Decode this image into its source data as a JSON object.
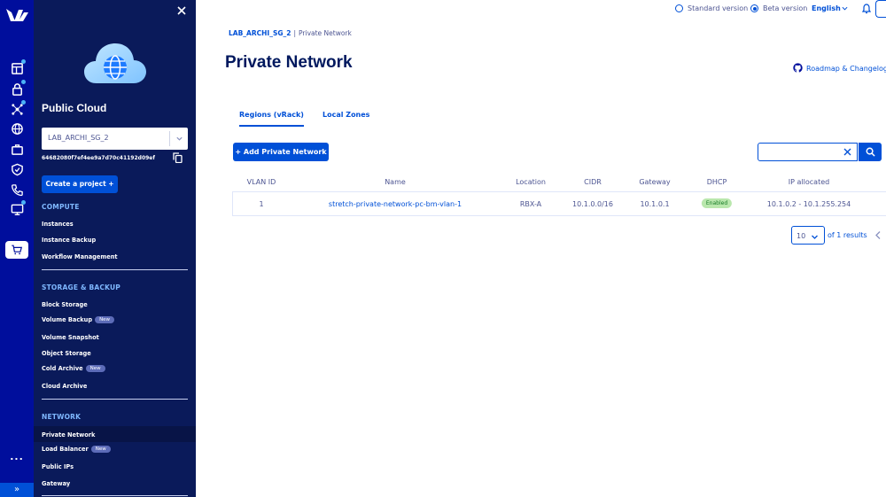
{
  "sidebar": {
    "title": "Public Cloud",
    "project_name": "LAB_ARCHI_SG_2",
    "project_id": "64682080f7ef4ee9a7d70c41192d09ef",
    "create_project_label": "Create a project +",
    "sections": {
      "compute": {
        "title": "COMPUTE",
        "items": [
          "Instances",
          "Instance Backup",
          "Workflow Management"
        ]
      },
      "storage": {
        "title": "STORAGE & BACKUP",
        "items": [
          "Block Storage",
          "Volume Backup",
          "Volume Snapshot",
          "Object Storage",
          "Cold Archive",
          "Cloud Archive"
        ]
      },
      "network": {
        "title": "NETWORK",
        "items": [
          "Private Network",
          "Load Balancer",
          "Public IPs",
          "Gateway"
        ]
      }
    },
    "new_badge": "New",
    "active_item": "Private Network"
  },
  "rail": {
    "more_label": "...",
    "expand_label": "»"
  },
  "topbar": {
    "standard_version": "Standard version",
    "beta_version": "Beta version",
    "selected_version": "Beta version",
    "language": "English"
  },
  "breadcrumb": {
    "project": "LAB_ARCHI_SG_2",
    "separator": "|",
    "current": "Private Network"
  },
  "page": {
    "title": "Private Network",
    "roadmap_label": "Roadmap & Changelog",
    "tabs": [
      "Regions (vRack)",
      "Local Zones"
    ],
    "active_tab": "Regions (vRack)",
    "add_button": "+ Add Private Network",
    "search_value": ""
  },
  "table": {
    "columns": [
      "VLAN ID",
      "Name",
      "Location",
      "CIDR",
      "Gateway",
      "DHCP",
      "IP allocated"
    ],
    "rows": [
      {
        "vlan_id": "1",
        "name": "stretch-private-network-pc-bm-vlan-1",
        "location": "RBX-A",
        "cidr": "10.1.0.0/16",
        "gateway": "10.1.0.1",
        "dhcp": "Enabled",
        "ip_allocated": "10.1.0.2 - 10.1.255.254"
      }
    ]
  },
  "pagination": {
    "per_page": "10",
    "results": "of 1 results"
  },
  "colors": {
    "rail": "#000e9c",
    "sidebar": "#0a1a5a",
    "primary": "#0050d7",
    "title": "#00185e",
    "status_enabled_bg": "#b9e7ad",
    "status_enabled_text": "#157a25"
  }
}
